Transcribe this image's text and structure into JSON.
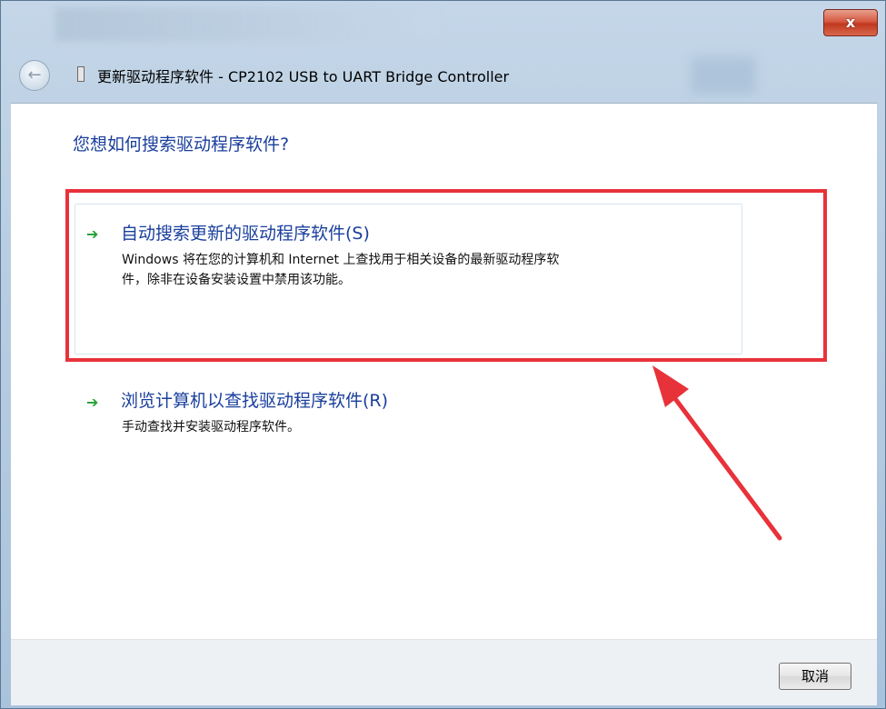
{
  "window": {
    "title": "更新驱动程序软件 - CP2102 USB to UART Bridge Controller",
    "close_label": "x"
  },
  "main": {
    "heading": "您想如何搜索驱动程序软件?",
    "options": [
      {
        "title": "自动搜索更新的驱动程序软件(S)",
        "description_line1": "Windows 将在您的计算机和 Internet 上查找用于相关设备的最新驱动程序软",
        "description_line2": "件，除非在设备安装设置中禁用该功能。"
      },
      {
        "title": "浏览计算机以查找驱动程序软件(R)",
        "description_line1": "手动查找并安装驱动程序软件。"
      }
    ]
  },
  "footer": {
    "cancel_label": "取消"
  },
  "icons": {
    "back": "back-arrow-icon",
    "device": "device-icon",
    "option_arrow": "green-arrow-icon"
  },
  "colors": {
    "heading": "#1a3f9c",
    "highlight": "#e8323a",
    "arrow": "#23a032"
  }
}
